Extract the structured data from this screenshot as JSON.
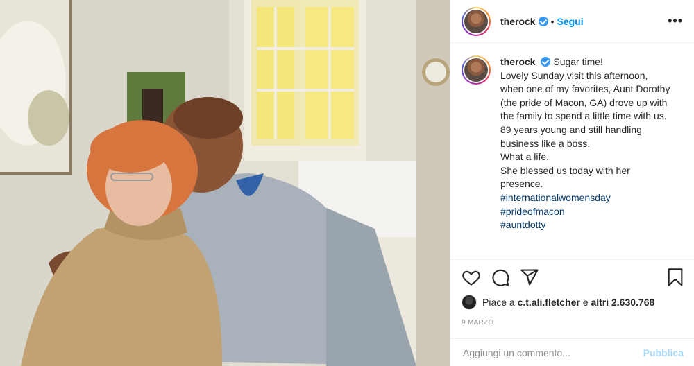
{
  "post": {
    "username": "therock",
    "follow_label": "Segui",
    "separator": "•",
    "more_label": "•••"
  },
  "caption": {
    "username": "therock",
    "lines": [
      "Sugar time!",
      "Lovely Sunday visit this afternoon,",
      "when one of my favorites, Aunt Dorothy",
      "(the pride of Macon, GA) drove up with",
      "the family to spend a little time with us.",
      "89 years young and still handling",
      "business like a boss.",
      "What a life.",
      "She blessed us today with her",
      "presence."
    ],
    "hashtags": [
      "#internationalwomensday",
      "#prideofmacon",
      "#auntdotty"
    ]
  },
  "likes": {
    "prefix": "Piace a",
    "user": "c.t.ali.fletcher",
    "middle": "e",
    "count_text": "altri 2.630.768"
  },
  "date": "9 MARZO",
  "comment_box": {
    "placeholder": "Aggiungi un commento...",
    "publish_label": "Pubblica"
  },
  "icons": {
    "like": "heart-icon",
    "comment": "comment-icon",
    "share": "share-icon",
    "save": "bookmark-icon",
    "verified": "verified-badge-icon"
  },
  "colors": {
    "accent": "#0095f6",
    "text": "#262626",
    "muted": "#8e8e8e",
    "hashtag": "#00376b",
    "verified": "#3897f0"
  }
}
